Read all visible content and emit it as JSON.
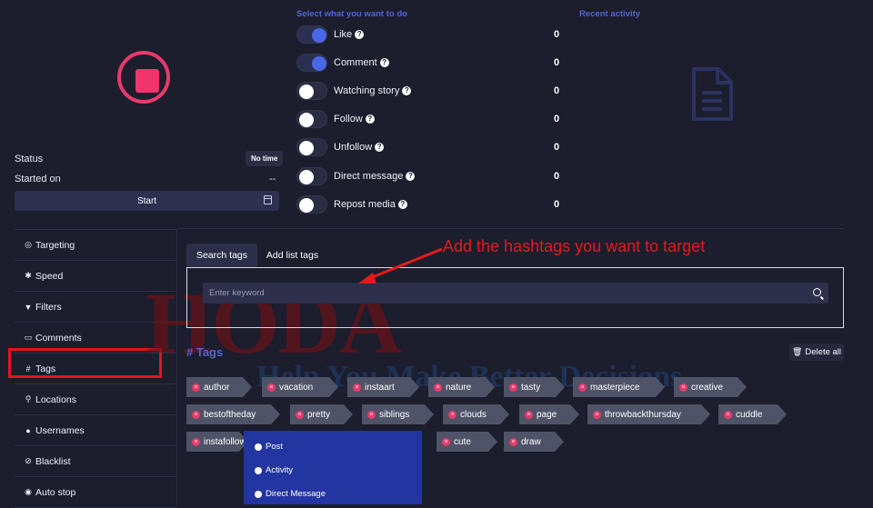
{
  "stop_control": {
    "icon": "stop-icon"
  },
  "status": {
    "label": "Status",
    "value": "No time"
  },
  "started_on": {
    "label": "Started on",
    "value": "--"
  },
  "start_button": {
    "label": "Start"
  },
  "actions_title": "Select what you want to do",
  "recent_activity_title": "Recent activity",
  "actions": [
    {
      "label": "Like",
      "enabled": true,
      "count": "0"
    },
    {
      "label": "Comment",
      "enabled": true,
      "count": "0"
    },
    {
      "label": "Watching story",
      "enabled": false,
      "count": "0"
    },
    {
      "label": "Follow",
      "enabled": false,
      "count": "0"
    },
    {
      "label": "Unfollow",
      "enabled": false,
      "count": "0"
    },
    {
      "label": "Direct message",
      "enabled": false,
      "count": "0"
    },
    {
      "label": "Repost media",
      "enabled": false,
      "count": "0"
    }
  ],
  "help_glyph": "?",
  "sidebar": {
    "items": [
      {
        "label": "Targeting",
        "icon": "target-icon",
        "glyph": "◎"
      },
      {
        "label": "Speed",
        "icon": "runner-icon",
        "glyph": "✱"
      },
      {
        "label": "Filters",
        "icon": "filter-icon",
        "glyph": "▼"
      },
      {
        "label": "Comments",
        "icon": "comment-icon",
        "glyph": "▭"
      },
      {
        "label": "Tags",
        "icon": "hash-icon",
        "glyph": "#"
      },
      {
        "label": "Locations",
        "icon": "pin-icon",
        "glyph": "⚲"
      },
      {
        "label": "Usernames",
        "icon": "user-icon",
        "glyph": "●"
      },
      {
        "label": "Blacklist",
        "icon": "ban-icon",
        "glyph": "⊘"
      },
      {
        "label": "Auto stop",
        "icon": "stop-circle-icon",
        "glyph": "◉"
      }
    ]
  },
  "tabs": [
    {
      "label": "Search tags",
      "active": true
    },
    {
      "label": "Add list tags",
      "active": false
    }
  ],
  "search": {
    "placeholder": "Enter keyword"
  },
  "annotation": "Add the hashtags you want to target",
  "watermark": {
    "main": "HODA",
    "sub": "Help You Make Better Decisions"
  },
  "tags_section": {
    "title": "# Tags",
    "delete_all": "Delete all"
  },
  "tags": [
    [
      "author",
      "vacation",
      "instaart",
      "nature",
      "tasty",
      "masterpiece",
      "creative"
    ],
    [
      "bestoftheday",
      "pretty",
      "siblings",
      "clouds",
      "page",
      "throwbackthursday",
      "cuddle"
    ],
    [
      "instafollow",
      "cute",
      "draw"
    ]
  ],
  "dropdown": {
    "items": [
      "Post",
      "Activity",
      "Direct Message"
    ]
  },
  "colors": {
    "accent": "#4f66d6",
    "stop": "#f0356c",
    "annotation": "#e41a1c"
  }
}
